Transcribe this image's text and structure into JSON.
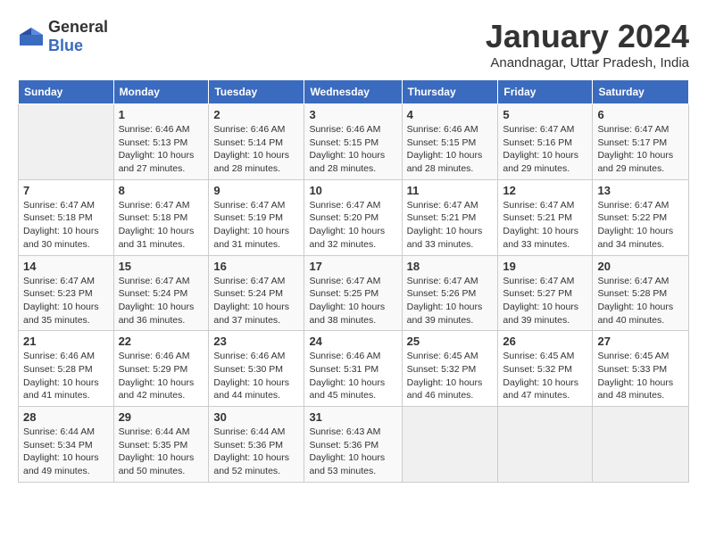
{
  "header": {
    "logo_general": "General",
    "logo_blue": "Blue",
    "month_title": "January 2024",
    "subtitle": "Anandnagar, Uttar Pradesh, India"
  },
  "days_of_week": [
    "Sunday",
    "Monday",
    "Tuesday",
    "Wednesday",
    "Thursday",
    "Friday",
    "Saturday"
  ],
  "weeks": [
    [
      {
        "day": "",
        "info": ""
      },
      {
        "day": "1",
        "info": "Sunrise: 6:46 AM\nSunset: 5:13 PM\nDaylight: 10 hours and 27 minutes."
      },
      {
        "day": "2",
        "info": "Sunrise: 6:46 AM\nSunset: 5:14 PM\nDaylight: 10 hours and 28 minutes."
      },
      {
        "day": "3",
        "info": "Sunrise: 6:46 AM\nSunset: 5:15 PM\nDaylight: 10 hours and 28 minutes."
      },
      {
        "day": "4",
        "info": "Sunrise: 6:46 AM\nSunset: 5:15 PM\nDaylight: 10 hours and 28 minutes."
      },
      {
        "day": "5",
        "info": "Sunrise: 6:47 AM\nSunset: 5:16 PM\nDaylight: 10 hours and 29 minutes."
      },
      {
        "day": "6",
        "info": "Sunrise: 6:47 AM\nSunset: 5:17 PM\nDaylight: 10 hours and 29 minutes."
      }
    ],
    [
      {
        "day": "7",
        "info": "Sunrise: 6:47 AM\nSunset: 5:18 PM\nDaylight: 10 hours and 30 minutes."
      },
      {
        "day": "8",
        "info": "Sunrise: 6:47 AM\nSunset: 5:18 PM\nDaylight: 10 hours and 31 minutes."
      },
      {
        "day": "9",
        "info": "Sunrise: 6:47 AM\nSunset: 5:19 PM\nDaylight: 10 hours and 31 minutes."
      },
      {
        "day": "10",
        "info": "Sunrise: 6:47 AM\nSunset: 5:20 PM\nDaylight: 10 hours and 32 minutes."
      },
      {
        "day": "11",
        "info": "Sunrise: 6:47 AM\nSunset: 5:21 PM\nDaylight: 10 hours and 33 minutes."
      },
      {
        "day": "12",
        "info": "Sunrise: 6:47 AM\nSunset: 5:21 PM\nDaylight: 10 hours and 33 minutes."
      },
      {
        "day": "13",
        "info": "Sunrise: 6:47 AM\nSunset: 5:22 PM\nDaylight: 10 hours and 34 minutes."
      }
    ],
    [
      {
        "day": "14",
        "info": "Sunrise: 6:47 AM\nSunset: 5:23 PM\nDaylight: 10 hours and 35 minutes."
      },
      {
        "day": "15",
        "info": "Sunrise: 6:47 AM\nSunset: 5:24 PM\nDaylight: 10 hours and 36 minutes."
      },
      {
        "day": "16",
        "info": "Sunrise: 6:47 AM\nSunset: 5:24 PM\nDaylight: 10 hours and 37 minutes."
      },
      {
        "day": "17",
        "info": "Sunrise: 6:47 AM\nSunset: 5:25 PM\nDaylight: 10 hours and 38 minutes."
      },
      {
        "day": "18",
        "info": "Sunrise: 6:47 AM\nSunset: 5:26 PM\nDaylight: 10 hours and 39 minutes."
      },
      {
        "day": "19",
        "info": "Sunrise: 6:47 AM\nSunset: 5:27 PM\nDaylight: 10 hours and 39 minutes."
      },
      {
        "day": "20",
        "info": "Sunrise: 6:47 AM\nSunset: 5:28 PM\nDaylight: 10 hours and 40 minutes."
      }
    ],
    [
      {
        "day": "21",
        "info": "Sunrise: 6:46 AM\nSunset: 5:28 PM\nDaylight: 10 hours and 41 minutes."
      },
      {
        "day": "22",
        "info": "Sunrise: 6:46 AM\nSunset: 5:29 PM\nDaylight: 10 hours and 42 minutes."
      },
      {
        "day": "23",
        "info": "Sunrise: 6:46 AM\nSunset: 5:30 PM\nDaylight: 10 hours and 44 minutes."
      },
      {
        "day": "24",
        "info": "Sunrise: 6:46 AM\nSunset: 5:31 PM\nDaylight: 10 hours and 45 minutes."
      },
      {
        "day": "25",
        "info": "Sunrise: 6:45 AM\nSunset: 5:32 PM\nDaylight: 10 hours and 46 minutes."
      },
      {
        "day": "26",
        "info": "Sunrise: 6:45 AM\nSunset: 5:32 PM\nDaylight: 10 hours and 47 minutes."
      },
      {
        "day": "27",
        "info": "Sunrise: 6:45 AM\nSunset: 5:33 PM\nDaylight: 10 hours and 48 minutes."
      }
    ],
    [
      {
        "day": "28",
        "info": "Sunrise: 6:44 AM\nSunset: 5:34 PM\nDaylight: 10 hours and 49 minutes."
      },
      {
        "day": "29",
        "info": "Sunrise: 6:44 AM\nSunset: 5:35 PM\nDaylight: 10 hours and 50 minutes."
      },
      {
        "day": "30",
        "info": "Sunrise: 6:44 AM\nSunset: 5:36 PM\nDaylight: 10 hours and 52 minutes."
      },
      {
        "day": "31",
        "info": "Sunrise: 6:43 AM\nSunset: 5:36 PM\nDaylight: 10 hours and 53 minutes."
      },
      {
        "day": "",
        "info": ""
      },
      {
        "day": "",
        "info": ""
      },
      {
        "day": "",
        "info": ""
      }
    ]
  ]
}
